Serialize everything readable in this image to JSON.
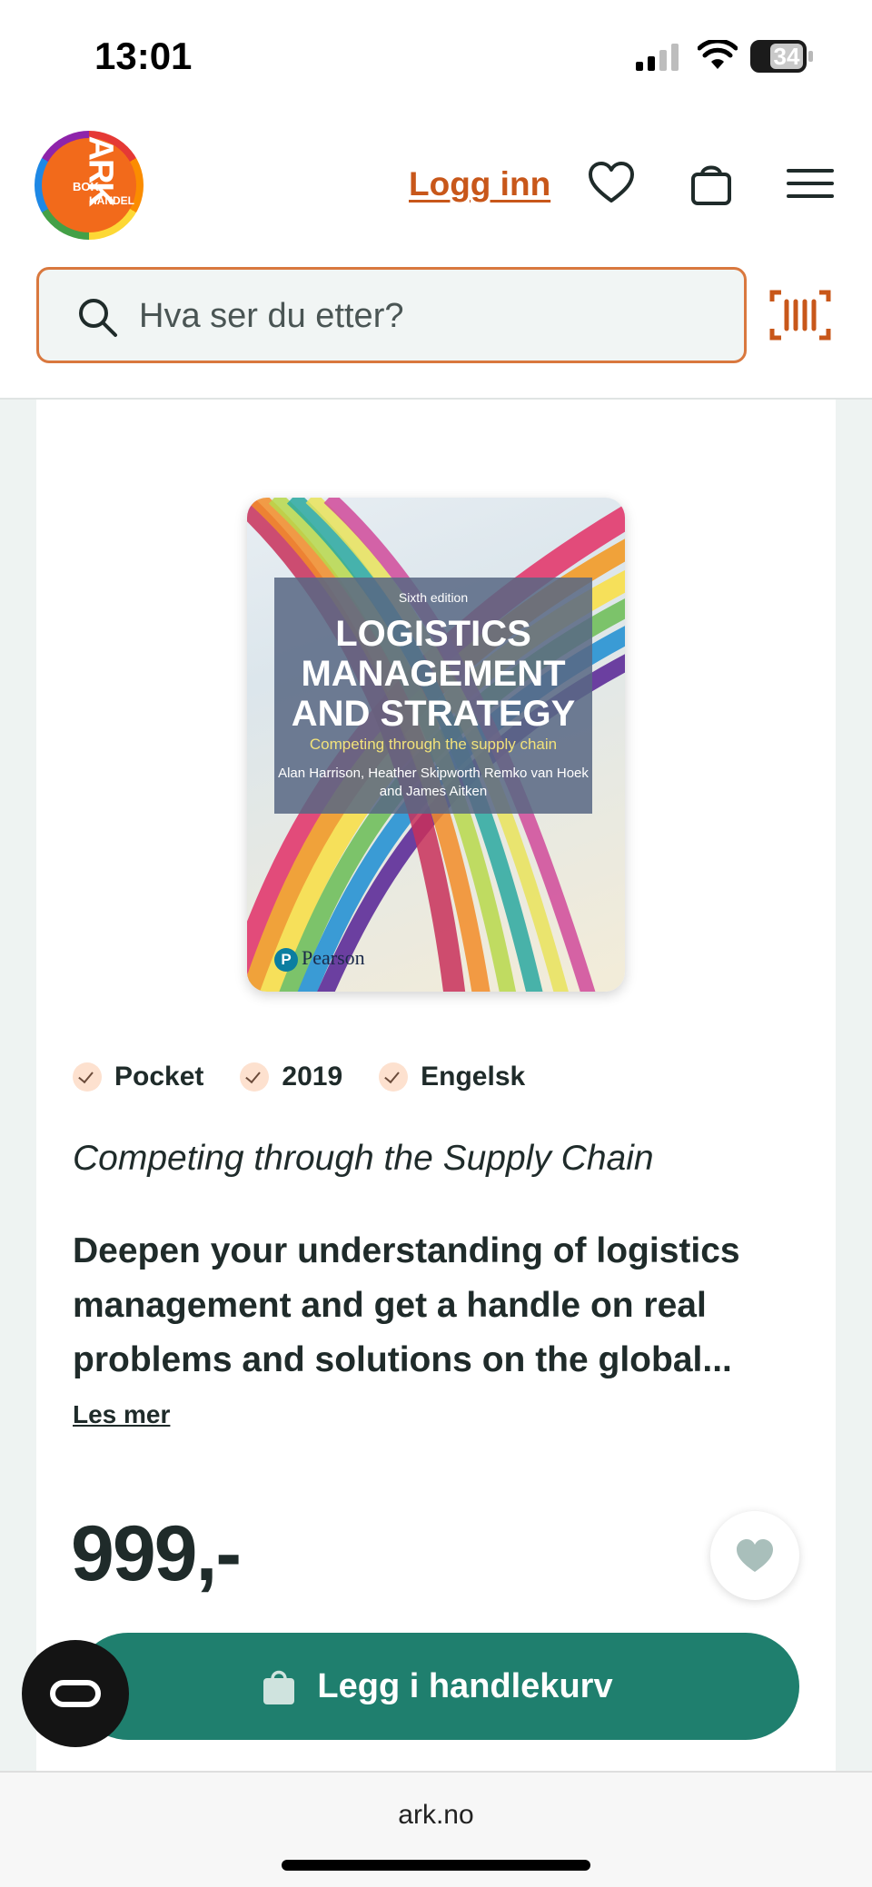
{
  "status_bar": {
    "time": "13:01",
    "battery": "34"
  },
  "header": {
    "logo": {
      "ark": "ARK",
      "bok": "BOK",
      "handel": "HANDEL"
    },
    "login_label": "Logg inn",
    "icons": [
      "heart-icon",
      "bag-icon",
      "menu-icon"
    ]
  },
  "search": {
    "placeholder": "Hva ser du etter?",
    "value": ""
  },
  "product": {
    "cover": {
      "edition": "Sixth edition",
      "title": "LOGISTICS MANAGEMENT AND STRATEGY",
      "subtitle": "Competing through the supply chain",
      "authors": "Alan Harrison, Heather Skipworth Remko van Hoek and James Aitken",
      "publisher": "Pearson",
      "publisher_mark": "P"
    },
    "tags": [
      "Pocket",
      "2019",
      "Engelsk"
    ],
    "subtitle": "Competing through the Supply Chain",
    "description": "Deepen your understanding of logistics management and get a handle on real problems and solutions on the global...",
    "read_more": "Les mer",
    "price": "999,-",
    "add_to_cart": "Legg i handlekurv"
  },
  "browser": {
    "url": "ark.no"
  },
  "colors": {
    "accent": "#c8571a",
    "primary_button": "#1f7f6e",
    "search_border": "#d9783e",
    "text": "#1f2b2a"
  }
}
